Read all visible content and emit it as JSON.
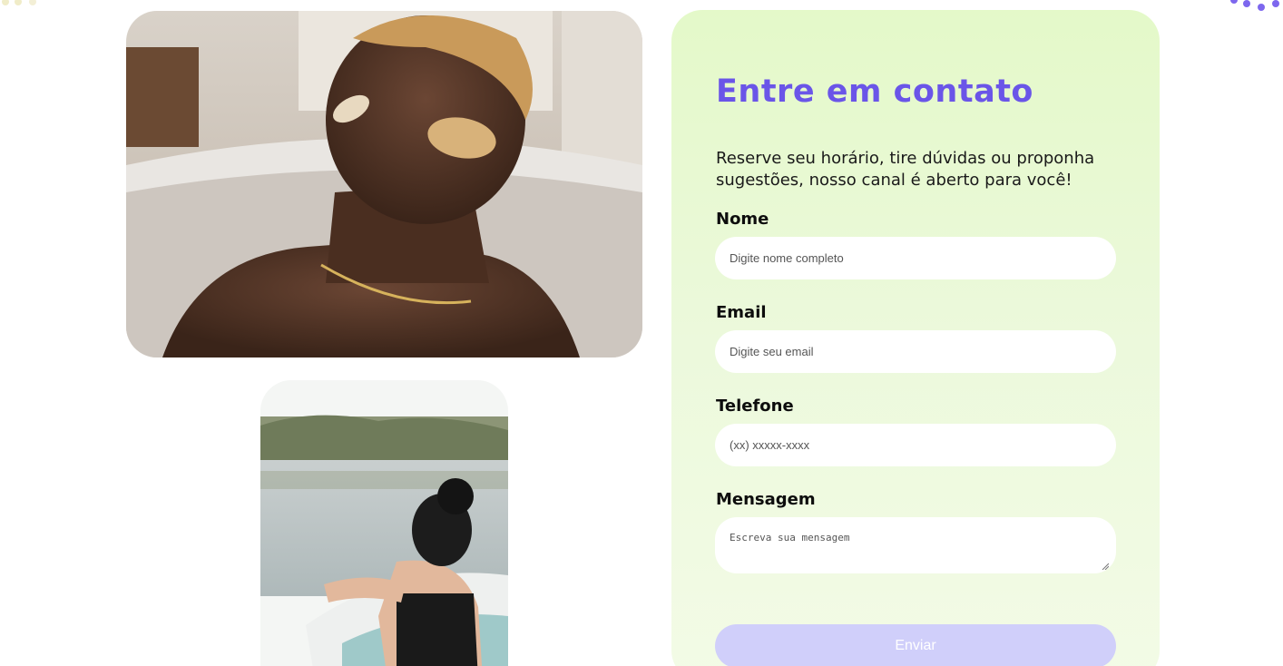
{
  "contact": {
    "title": "Entre em contato",
    "description": "Reserve seu horário, tire dúvidas ou proponha sugestões, nosso canal é aberto para você!",
    "fields": {
      "name": {
        "label": "Nome",
        "placeholder": "Digite nome completo"
      },
      "email": {
        "label": "Email",
        "placeholder": "Digite seu email"
      },
      "phone": {
        "label": "Telefone",
        "placeholder": "(xx) xxxxx-xxxx"
      },
      "message": {
        "label": "Mensagem",
        "placeholder": "Escreva sua mensagem"
      }
    },
    "submit_label": "Enviar"
  },
  "colors": {
    "accent": "#6a55e8",
    "card_background": "#e4f9c9",
    "button_background": "#d0cffa"
  }
}
